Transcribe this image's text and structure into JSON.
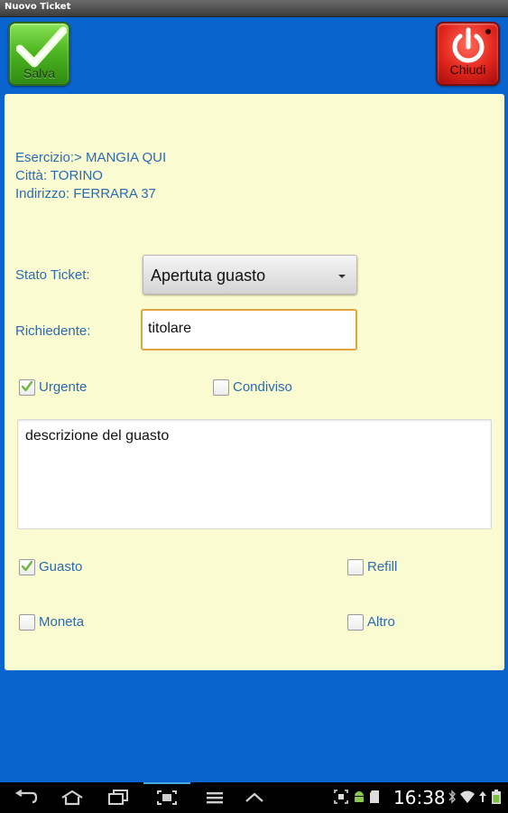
{
  "window": {
    "title": "Nuovo Ticket"
  },
  "toolbar": {
    "save_label": "Salva",
    "close_label": "Chiudi"
  },
  "info": {
    "esercizio": "Esercizio:> MANGIA QUI",
    "citta": "Città: TORINO",
    "indirizzo": "Indirizzo: FERRARA 37"
  },
  "form": {
    "stato_label": "Stato Ticket:",
    "stato_value": "Apertuta guasto",
    "richiedente_label": "Richiedente:",
    "richiedente_value": "titolare",
    "urgente": {
      "label": "Urgente",
      "checked": true
    },
    "condiviso": {
      "label": "Condiviso",
      "checked": false
    },
    "descrizione": "descrizione del guasto",
    "guasto": {
      "label": "Guasto",
      "checked": true
    },
    "refill": {
      "label": "Refill",
      "checked": false
    },
    "moneta": {
      "label": "Moneta",
      "checked": false
    },
    "altro": {
      "label": "Altro",
      "checked": false
    }
  },
  "statusbar": {
    "time": "16:38"
  },
  "colors": {
    "background": "#0a64cf",
    "panel": "#fbfbd1",
    "label": "#2a6bb3",
    "focus": "#e3a43d"
  },
  "icons": {
    "save": "checkmark-icon",
    "close": "power-icon",
    "nav": [
      "back-icon",
      "home-icon",
      "recent-apps-icon",
      "screenshot-icon",
      "menu-icon",
      "up-icon"
    ]
  }
}
